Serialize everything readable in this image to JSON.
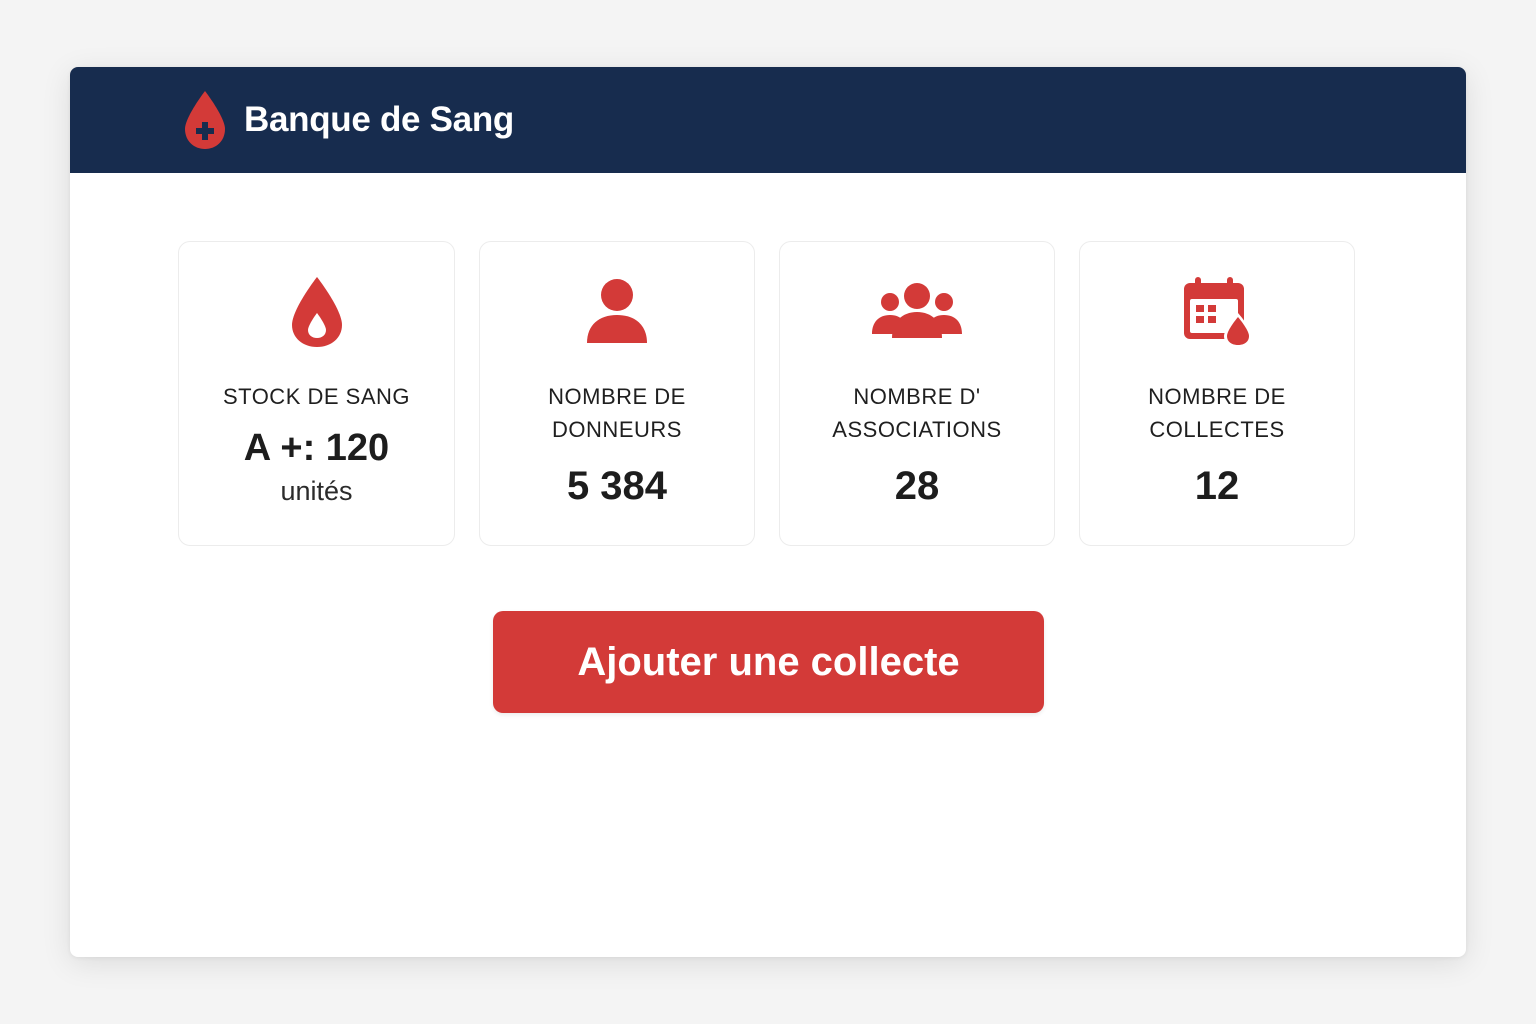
{
  "header": {
    "title": "Banque de Sang",
    "logo_icon": "blood-drop-plus-icon"
  },
  "colors": {
    "header_bg": "#172c4e",
    "accent": "#d33a38"
  },
  "stats": [
    {
      "icon": "blood-drop-icon",
      "label": "STOCK DE SANG",
      "value": "A +: 120",
      "unit": "unités"
    },
    {
      "icon": "user-icon",
      "label": "NOMBRE DE DONNEURS",
      "value": "5 384"
    },
    {
      "icon": "group-icon",
      "label": "NOMBRE D' ASSOCIATIONS",
      "value": "28"
    },
    {
      "icon": "calendar-drop-icon",
      "label": "NOMBRE DE COLLECTES",
      "value": "12"
    }
  ],
  "actions": {
    "add_collection_label": "Ajouter une collecte"
  }
}
